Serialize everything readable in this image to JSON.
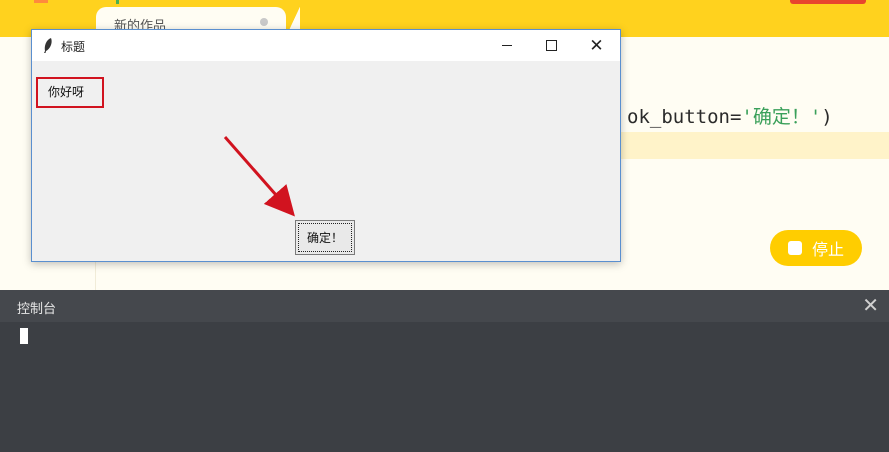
{
  "top": {
    "tab_label": "新的作品"
  },
  "editor": {
    "code_prefix": "ok_button=",
    "code_string": "'确定！'",
    "code_suffix": ")",
    "stop_label": "停止"
  },
  "dialog": {
    "title": "标题",
    "message": "你好呀",
    "ok_label": "确定！",
    "minimize": "–",
    "close": "✕"
  },
  "console": {
    "title": "控制台",
    "close": "✕"
  },
  "colors": {
    "accent": "#ffd21e",
    "highlight_red": "#d1131f",
    "console_bg": "#3c3f44"
  }
}
